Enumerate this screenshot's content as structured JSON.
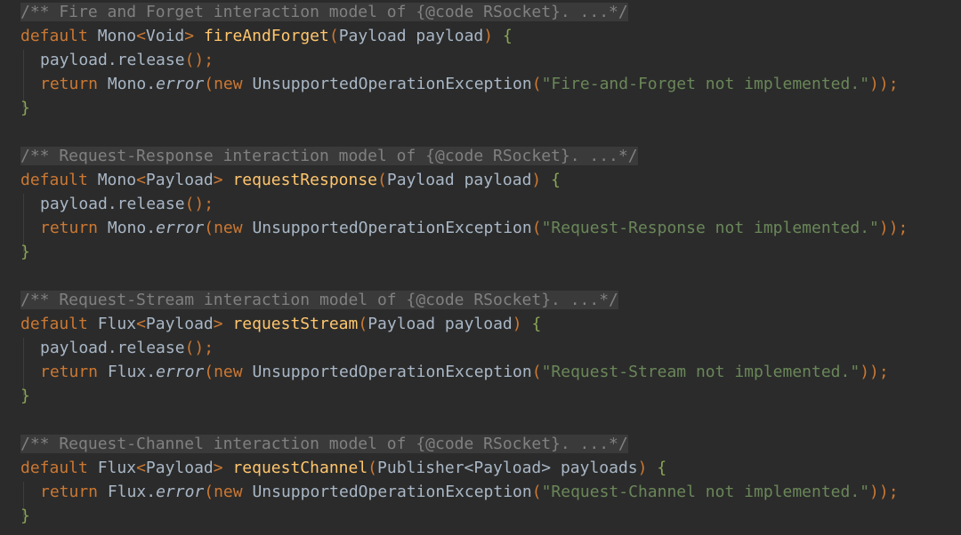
{
  "colors": {
    "background": "#2b2b2b",
    "comment": "#808080",
    "keyword": "#cc7832",
    "method": "#ffc66d",
    "string": "#6a8759",
    "text": "#a9b7c6",
    "brace": "#8aa657"
  },
  "blocks": [
    {
      "comment": "/** Fire and Forget interaction model of {@code RSocket}. ...*/",
      "kw_default": "default",
      "ret_type": "Mono",
      "gen_open": "<",
      "type_param": "Void",
      "gen_close": ">",
      "method": "fireAndForget",
      "paren_open": "(",
      "param_type": "Payload",
      "param_name": "payload",
      "paren_close": ")",
      "brace_open": "{",
      "release_obj": "payload.release",
      "release_parens": "();",
      "kw_return": "return",
      "static_cls": "Mono.",
      "static_method": "error",
      "p1": "(",
      "kw_new": "new",
      "exception": "UnsupportedOperationException",
      "p2": "(",
      "message": "\"Fire-and-Forget not implemented.\"",
      "closing": "));",
      "brace_close": "}"
    },
    {
      "comment": "/** Request-Response interaction model of {@code RSocket}. ...*/",
      "kw_default": "default",
      "ret_type": "Mono",
      "gen_open": "<",
      "type_param": "Payload",
      "gen_close": ">",
      "method": "requestResponse",
      "paren_open": "(",
      "param_type": "Payload",
      "param_name": "payload",
      "paren_close": ")",
      "brace_open": "{",
      "release_obj": "payload.release",
      "release_parens": "();",
      "kw_return": "return",
      "static_cls": "Mono.",
      "static_method": "error",
      "p1": "(",
      "kw_new": "new",
      "exception": "UnsupportedOperationException",
      "p2": "(",
      "message": "\"Request-Response not implemented.\"",
      "closing": "));",
      "brace_close": "}"
    },
    {
      "comment": "/** Request-Stream interaction model of {@code RSocket}. ...*/",
      "kw_default": "default",
      "ret_type": "Flux",
      "gen_open": "<",
      "type_param": "Payload",
      "gen_close": ">",
      "method": "requestStream",
      "paren_open": "(",
      "param_type": "Payload",
      "param_name": "payload",
      "paren_close": ")",
      "brace_open": "{",
      "release_obj": "payload.release",
      "release_parens": "();",
      "kw_return": "return",
      "static_cls": "Flux.",
      "static_method": "error",
      "p1": "(",
      "kw_new": "new",
      "exception": "UnsupportedOperationException",
      "p2": "(",
      "message": "\"Request-Stream not implemented.\"",
      "closing": "));",
      "brace_close": "}"
    },
    {
      "comment": "/** Request-Channel interaction model of {@code RSocket}. ...*/",
      "kw_default": "default",
      "ret_type": "Flux",
      "gen_open": "<",
      "type_param": "Payload",
      "gen_close": ">",
      "method": "requestChannel",
      "paren_open": "(",
      "param_type": "Publisher<Payload>",
      "param_name": "payloads",
      "paren_close": ")",
      "brace_open": "{",
      "kw_return": "return",
      "static_cls": "Flux.",
      "static_method": "error",
      "p1": "(",
      "kw_new": "new",
      "exception": "UnsupportedOperationException",
      "p2": "(",
      "message": "\"Request-Channel not implemented.\"",
      "closing": "));",
      "brace_close": "}"
    }
  ]
}
